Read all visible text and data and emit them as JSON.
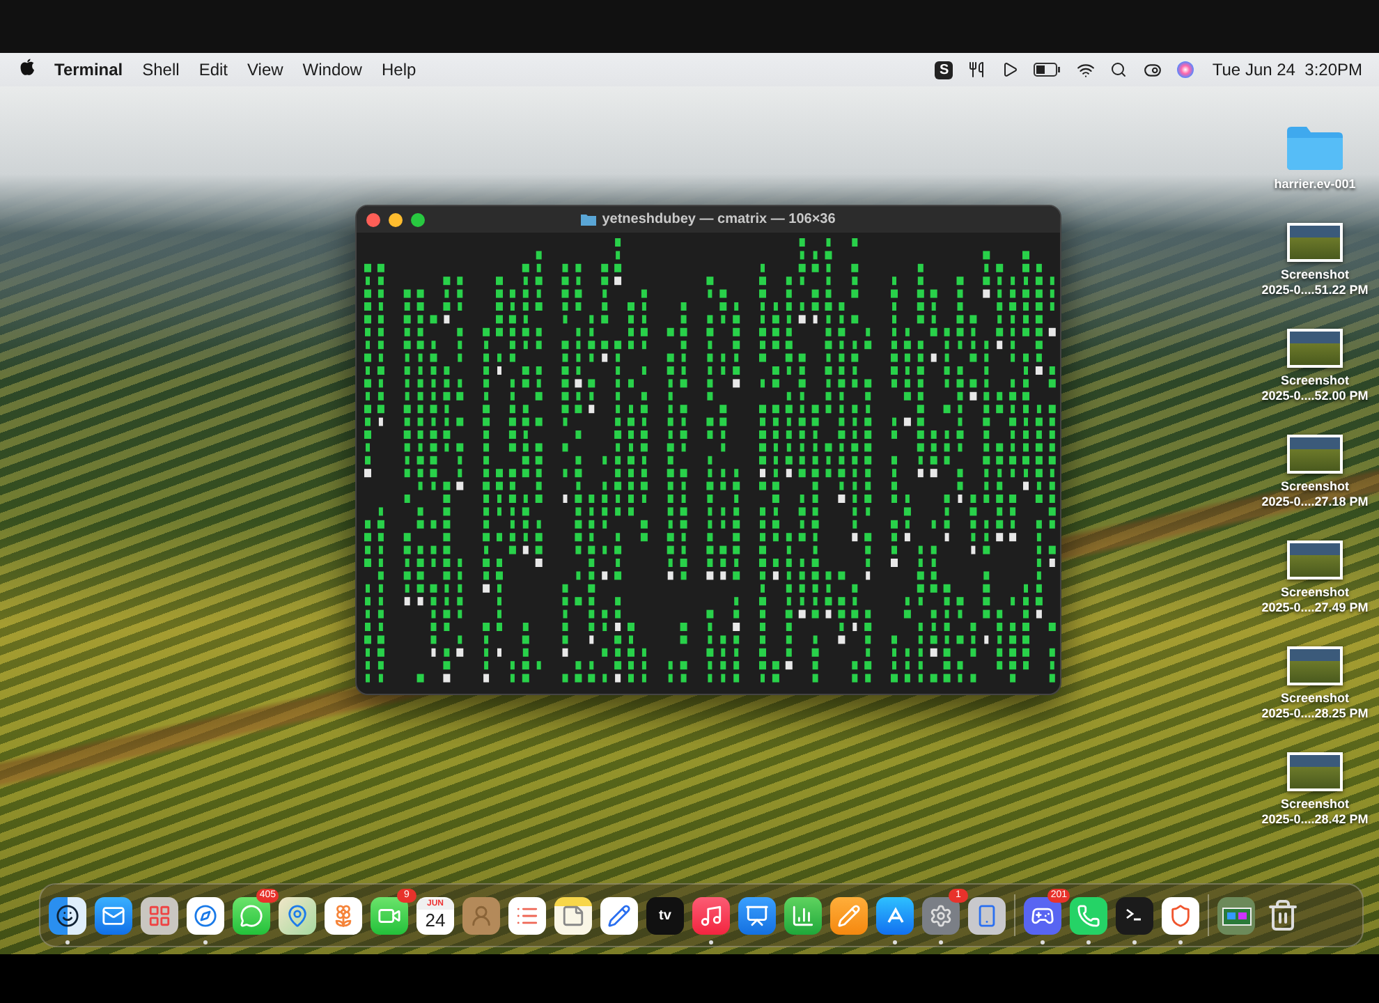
{
  "menu_bar": {
    "app_name": "Terminal",
    "menus": [
      "Shell",
      "Edit",
      "View",
      "Window",
      "Help"
    ],
    "status_icons": [
      {
        "kind": "letter",
        "label": "S"
      },
      {
        "kind": "fork"
      },
      {
        "kind": "play"
      },
      {
        "kind": "battery"
      },
      {
        "kind": "wifi"
      },
      {
        "kind": "search"
      },
      {
        "kind": "control"
      },
      {
        "kind": "siri"
      }
    ],
    "clock": "Tue Jun 24  3:20PM"
  },
  "terminal_window": {
    "title": "yetneshdubey — cmatrix — 106×36"
  },
  "desktop_items": [
    {
      "kind": "folder",
      "label": "harrier.ev-001"
    },
    {
      "kind": "screenshot",
      "label": "Screenshot\n2025-0....51.22 PM"
    },
    {
      "kind": "screenshot",
      "label": "Screenshot\n2025-0....52.00 PM"
    },
    {
      "kind": "screenshot",
      "label": "Screenshot\n2025-0....27.18 PM"
    },
    {
      "kind": "screenshot",
      "label": "Screenshot\n2025-0....27.49 PM"
    },
    {
      "kind": "screenshot",
      "label": "Screenshot\n2025-0....28.25 PM"
    },
    {
      "kind": "screenshot",
      "label": "Screenshot\n2025-0....28.42 PM"
    }
  ],
  "dock": {
    "apps": [
      {
        "kind": "finder",
        "running": true
      },
      {
        "kind": "mail",
        "running": false
      },
      {
        "kind": "launchpad",
        "running": false
      },
      {
        "kind": "safari",
        "running": true
      },
      {
        "kind": "messages",
        "running": false,
        "badge": "405"
      },
      {
        "kind": "maps",
        "running": false
      },
      {
        "kind": "photos",
        "running": false
      },
      {
        "kind": "facetime",
        "running": false,
        "badge": "9"
      },
      {
        "kind": "calendar",
        "running": false,
        "month": "JUN",
        "day": "24"
      },
      {
        "kind": "contacts",
        "running": false
      },
      {
        "kind": "reminders",
        "running": false
      },
      {
        "kind": "notes",
        "running": false
      },
      {
        "kind": "freeform",
        "running": false
      },
      {
        "kind": "tv",
        "running": false,
        "label": "tv"
      },
      {
        "kind": "music",
        "running": true
      },
      {
        "kind": "keynote",
        "running": false
      },
      {
        "kind": "numbers",
        "running": false
      },
      {
        "kind": "pages",
        "running": false
      },
      {
        "kind": "appstore",
        "running": true
      },
      {
        "kind": "settings",
        "running": true,
        "badge": "1"
      },
      {
        "kind": "mirroring",
        "running": false
      },
      {
        "kind": "separator"
      },
      {
        "kind": "discord",
        "running": true,
        "badge": "201"
      },
      {
        "kind": "whatsapp",
        "running": true
      },
      {
        "kind": "terminal",
        "running": true
      },
      {
        "kind": "brave",
        "running": true
      },
      {
        "kind": "separator"
      },
      {
        "kind": "stack",
        "running": false
      },
      {
        "kind": "trash",
        "running": false
      }
    ]
  }
}
